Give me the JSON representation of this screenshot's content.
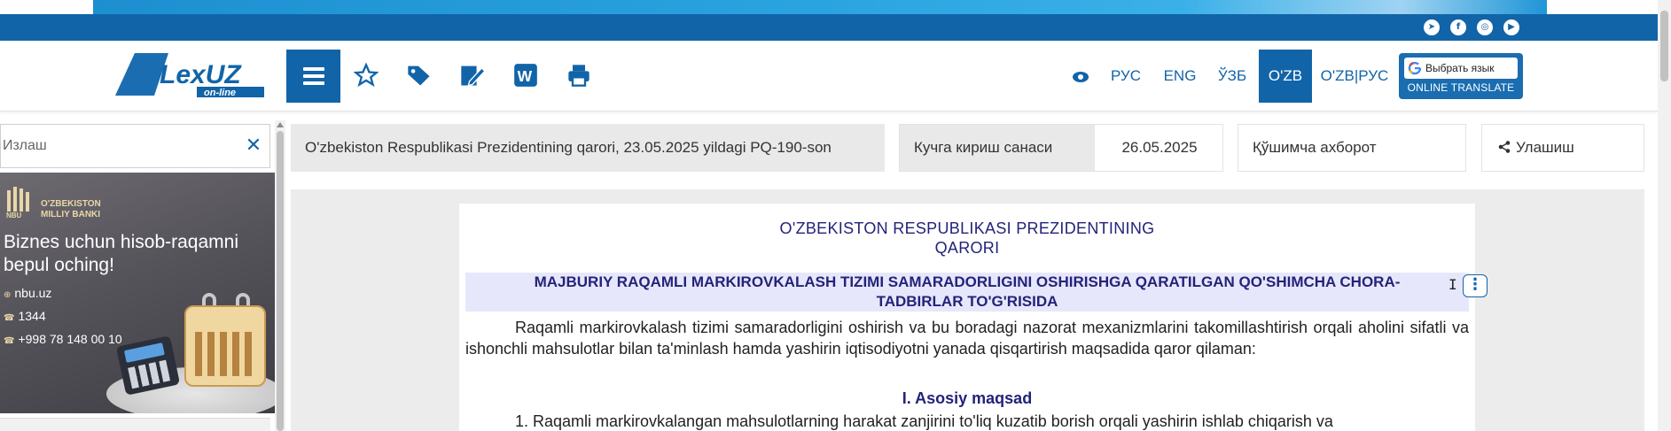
{
  "colors": {
    "brand_blue": "#1264a8",
    "doc_navy": "#23237a",
    "heading_bg": "#e7e7fb"
  },
  "social_icons": [
    "telegram-icon",
    "facebook-icon",
    "instagram-icon",
    "youtube-icon"
  ],
  "header": {
    "logo_text": "LexUZ",
    "logo_sub": "on-line",
    "tools": [
      "favorites-star-icon",
      "tags-icon",
      "edit-document-icon",
      "word-export-icon",
      "print-icon"
    ],
    "languages": [
      {
        "label": "РУС",
        "active": false
      },
      {
        "label": "ENG",
        "active": false
      },
      {
        "label": "ЎЗБ",
        "active": false
      },
      {
        "label": "O'ZB",
        "active": true
      },
      {
        "label": "O'ZB|РУС",
        "active": false
      }
    ],
    "translate": {
      "button": "Выбрать язык",
      "caption": "ONLINE TRANSLATE"
    }
  },
  "sidebar": {
    "search_placeholder": "Излаш",
    "clear_icon": "close-x-icon",
    "ad": {
      "bank": "O'ZBEKISTON MILLIY BANKI",
      "logo_letters": "NBU",
      "headline": "Biznes uchun hisob-raqamni bepul oching!",
      "site": "nbu.uz",
      "short_phone": "1344",
      "phone": "+998 78 148 00 10"
    }
  },
  "info_bar": {
    "doc_title": "O'zbekiston Respublikasi Prezidentining qarori, 23.05.2025 yildagi PQ-190-son",
    "effective_label": "Кучга кириш санаси",
    "effective_date": "26.05.2025",
    "extra": "Қўшимча ахборот",
    "share": "Улашиш"
  },
  "document": {
    "header_line1": "O'ZBEKISTON RESPUBLIKASI PREZIDENTINING",
    "header_line2": "QARORI",
    "heading_line1": "MAJBURIY RAQAMLI MARKIROVKALASH TIZIMI SAMARADORLIGINI OSHIRISHGA QARATILGAN QO'SHIMCHA CHORA-",
    "heading_line2": "TADBIRLAR TO'G'RISIDA",
    "paragraph": "Raqamli markirovkalash tizimi samaradorligini oshirish va bu boradagi nazorat mexanizmlarini takomillashtirish orqali aholini sifatli va ishonchli mahsulotlar bilan ta'minlash hamda yashirin iqtisodiyotni yanada qisqartirish maqsadida qaror qilaman:",
    "section": "I. Asosiy maqsad",
    "item1": "1. Raqamli markirovkalangan mahsulotlarning harakat zanjirini to'liq kuzatib borish orqali yashirin ishlab chiqarish va"
  }
}
